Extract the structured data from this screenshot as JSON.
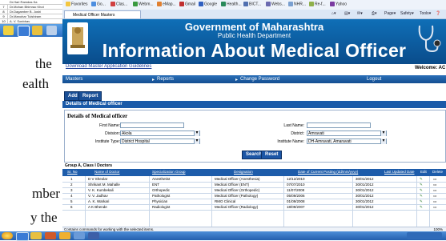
{
  "doc_table": {
    "rows": [
      {
        "no": "",
        "text": "Dr.Hari Ramdas Ka"
      },
      {
        "no": "7",
        "text": "Dr.Mohan Bhimrao Khot"
      },
      {
        "no": "8",
        "text": "Dr.Dagamber B. Joshi"
      },
      {
        "no": "9",
        "text": "Dr.Manohar Tulshiram"
      },
      {
        "no": "10",
        "text": "A. V. Sonbhav"
      }
    ]
  },
  "doc_text": {
    "line1": "the",
    "line2": "ealth",
    "line3": "mber",
    "line4": "y the"
  },
  "favorites": {
    "label": "Favorites",
    "items": [
      "Go...",
      "Clas...",
      "Webm...",
      "eMap...",
      "Gmail",
      "Google",
      "Health...",
      "BICT...",
      "Webs...",
      "NHR...",
      "Re-f...",
      "Yahoo"
    ]
  },
  "tab": {
    "title": "Medical Officer Masters"
  },
  "commands": {
    "page": "Page",
    "safety": "Safety",
    "tools": "Tools"
  },
  "banner": {
    "gov": "Government of Maharashtra",
    "dept": "Public Health Department",
    "title": "Information About Medical Officer"
  },
  "links": {
    "guidelines": "Download Master Application Guidelines",
    "welcome": "Welcome: AC"
  },
  "menu": {
    "masters": "Masters",
    "reports": "Reports",
    "change_password": "Change Password",
    "logout": "Logout"
  },
  "actions": {
    "add": "Add",
    "report": "Report"
  },
  "section": {
    "title": "Details of Medical officer"
  },
  "form": {
    "title": "Details of Medical officer",
    "first_name_label": "First Name:",
    "first_name_value": "",
    "last_name_label": "Last Name:",
    "last_name_value": "",
    "division_label": "Division:",
    "division_value": "Akola",
    "district_label": "District:",
    "district_value": "Amravati",
    "institute_type_label": "Institute Type:",
    "institute_type_value": "District Hospital",
    "institute_name_label": "Institute Name:",
    "institute_name_value": "DH-Amravati, Amaravati",
    "search": "Search",
    "reset": "Reset"
  },
  "group": {
    "title": "Group A, Class I Doctors"
  },
  "table": {
    "headers": [
      "Sr. No",
      "Name of Doctor",
      "Specialization Group",
      "Designation",
      "Date of Current Posting (dd/mm/yyyy)",
      "Last Updated Date",
      "Edit",
      "Delete"
    ],
    "rows": [
      [
        "1",
        "D V Sheolar",
        "Anesthetist",
        "Medical Officer (Anesthesia)",
        "12/12/2010",
        "30/01/2012"
      ],
      [
        "2",
        "Shrikant M. Mahalle",
        "ENT",
        "Medical Officer (ENT)",
        "07/07/2010",
        "30/01/2012"
      ],
      [
        "3",
        "V. K. Kumbekali",
        "Orthopedic",
        "Medical Officer (Orthopedic)",
        "11/07/2008",
        "30/01/2012"
      ],
      [
        "4",
        "V. V. Jadhav",
        "Pathologist",
        "Medical Officer (Pathology)",
        "05/09/2006",
        "30/01/2012"
      ],
      [
        "5",
        "A. K. Warkari",
        "Physician",
        "RMO Clinical",
        "01/09/2008",
        "30/01/2012"
      ],
      [
        "6",
        "A K Bhende",
        "Radiologist",
        "Medical Officer (Radiology)",
        "18/09/2007",
        "30/01/2012"
      ]
    ]
  },
  "status": {
    "text": "Contains commands for working with the selected items.",
    "zoom": "100%"
  }
}
